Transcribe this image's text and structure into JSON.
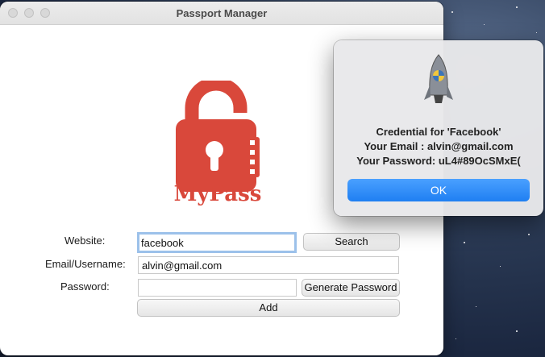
{
  "window": {
    "title": "Passport Manager"
  },
  "logo": {
    "text": "MyPass",
    "icon": "padlock-open-icon",
    "color": "#d9483b"
  },
  "form": {
    "website_label": "Website:",
    "website_value": "facebook",
    "search_label": "Search",
    "email_label": "Email/Username:",
    "email_value": "alvin@gmail.com",
    "password_label": "Password:",
    "password_value": "",
    "generate_label": "Generate Password",
    "add_label": "Add"
  },
  "alert": {
    "icon": "python-rocket-icon",
    "line1": "Credential for 'Facebook'",
    "line2": "Your Email : alvin@gmail.com",
    "line3": "Your Password: uL4#89OcSMxE(",
    "ok_label": "OK",
    "ok_color": "#2b86f5"
  }
}
